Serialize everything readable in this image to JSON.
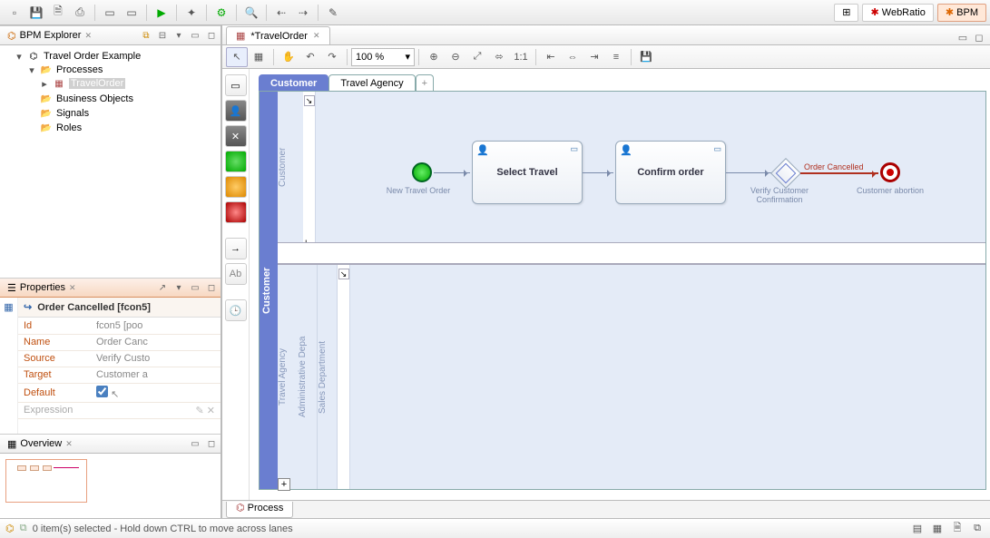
{
  "perspectives": {
    "open": "",
    "webratio": "WebRatio",
    "bpm": "BPM"
  },
  "explorer": {
    "title": "BPM Explorer",
    "root": "Travel Order Example",
    "nodes": {
      "processes": "Processes",
      "travelorder": "TravelOrder",
      "business_objects": "Business Objects",
      "signals": "Signals",
      "roles": "Roles"
    }
  },
  "editor": {
    "tab": "*TravelOrder",
    "zoom": "100 %",
    "bottom_tab": "Process",
    "pool_tabs": {
      "customer": "Customer",
      "travel_agency": "Travel Agency",
      "add": "+"
    },
    "pool_title": "Customer",
    "lanes": {
      "customer": "Customer",
      "sales": "Sales Department",
      "admin": "Administrative Depa",
      "agency": "Travel Agency"
    },
    "nodes": {
      "start_label": "New Travel Order",
      "select_travel": "Select Travel",
      "confirm_order": "Confirm order",
      "gateway_label": "Verify Customer Confirmation",
      "end_label": "Customer abortion",
      "sel_flow_label": "Order Cancelled"
    }
  },
  "properties": {
    "title_view": "Properties",
    "title": "Order Cancelled [fcon5]",
    "rows": {
      "id_l": "Id",
      "id_v": "fcon5 [poo",
      "name_l": "Name",
      "name_v": "Order Canc",
      "source_l": "Source",
      "source_v": "Verify Custo",
      "target_l": "Target",
      "target_v": "Customer a",
      "default_l": "Default",
      "expr_l": "Expression",
      "expr_v": ""
    }
  },
  "overview": {
    "title": "Overview"
  },
  "status": {
    "msg": "0 item(s) selected - Hold down CTRL to move across lanes"
  }
}
